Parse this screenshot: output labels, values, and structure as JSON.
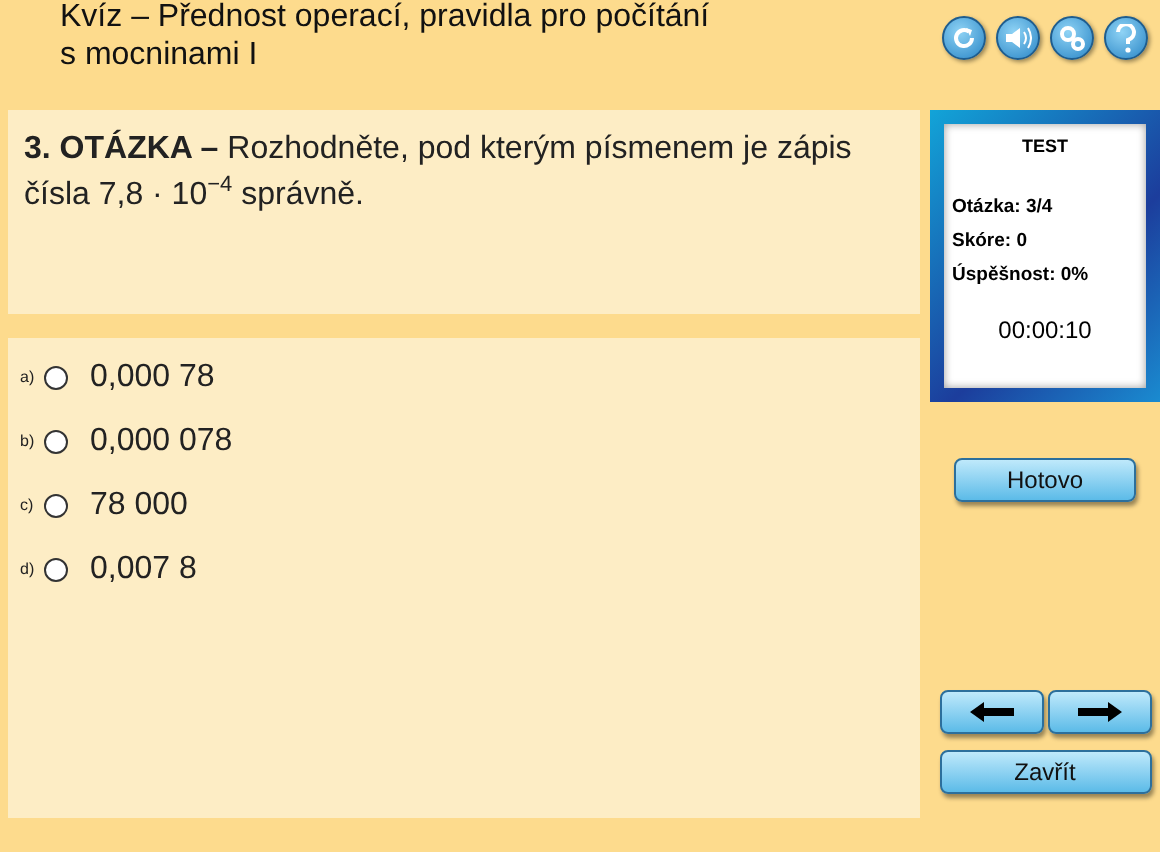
{
  "header": {
    "title_lines": [
      "Kvíz – Přednost operací, pravidla pro počítání",
      "s mocninami I"
    ]
  },
  "toolbar": [
    {
      "kind": "reload"
    },
    {
      "kind": "sound"
    },
    {
      "kind": "settings"
    },
    {
      "kind": "help"
    }
  ],
  "question": {
    "text": "**3. OTÁZKA –** Rozhodněte, pod kterým písmenem je zápis čísla 7,8 · 10$^{−4}$ správně."
  },
  "answers": [
    {
      "letter": "a)",
      "text": "0,000 78",
      "selected": false
    },
    {
      "letter": "b)",
      "text": "0,000 078",
      "selected": false
    },
    {
      "letter": "c)",
      "text": "78 000",
      "selected": false
    },
    {
      "letter": "d)",
      "text": "0,007 8",
      "selected": false
    }
  ],
  "test_panel": {
    "title": "TEST",
    "stats": [
      "Otázka: 3/4",
      "Skóre: 0",
      "Úspěšnost: 0%"
    ],
    "timer": "00:00:10"
  },
  "buttons": {
    "done": "Hotovo",
    "close": "Zavřít"
  }
}
